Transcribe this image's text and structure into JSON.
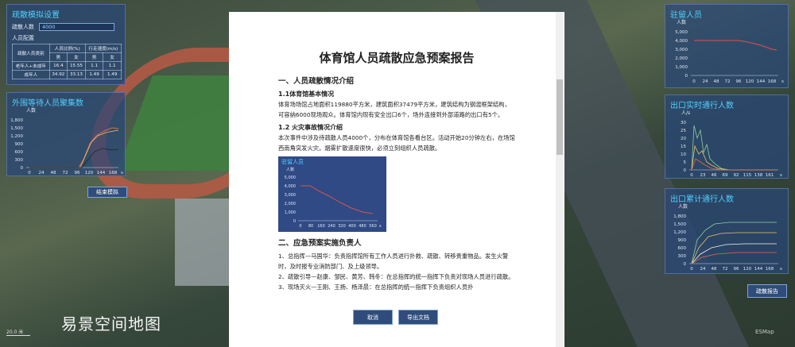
{
  "left_panel": {
    "title": "疏散模拟设置",
    "count_label": "疏散人数",
    "count_value": "4000",
    "people_config_label": "人员配置",
    "table_headers": [
      "疏散人员类别",
      "人员比例(%)",
      "行走速度(m/s)"
    ],
    "sub_headers": [
      "男",
      "女",
      "男",
      "女"
    ],
    "rows": [
      {
        "label": "老年人+未成年",
        "vals": [
          "16.4",
          "15.55",
          "1.1",
          "1.1"
        ]
      },
      {
        "label": "成年人",
        "vals": [
          "34.92",
          "33.13",
          "1.49",
          "1.49"
        ]
      }
    ]
  },
  "gather_panel": {
    "title": "外围等待人员聚集数",
    "ylabel": "人数",
    "yticks": [
      "1,800",
      "1,500",
      "1,200",
      "900",
      "600",
      "300",
      "0"
    ],
    "xticks": [
      "0",
      "24",
      "48",
      "72",
      "96",
      "120",
      "144",
      "168"
    ],
    "xunit": "s"
  },
  "end_button": "结束模拟",
  "right_top": {
    "title": "驻留人员",
    "ylabel": "人数",
    "yticks": [
      "5,000",
      "4,000",
      "3,000",
      "2,000",
      "1,000",
      "0"
    ],
    "xticks": [
      "0",
      "24",
      "48",
      "72",
      "96",
      "120",
      "144",
      "168"
    ],
    "xunit": "s"
  },
  "right_mid": {
    "title": "出口实时通行人数",
    "ylabel": "人/s",
    "yticks": [
      "30",
      "25",
      "20",
      "15",
      "10",
      "5",
      "0"
    ],
    "xticks": [
      "0",
      "23",
      "46",
      "69",
      "92",
      "115",
      "138",
      "161"
    ],
    "xunit": "s"
  },
  "right_bot": {
    "title": "出口累计通行人数",
    "ylabel": "人数",
    "yticks": [
      "1,800",
      "1,500",
      "1,200",
      "900",
      "600",
      "300",
      "0"
    ],
    "xticks": [
      "0",
      "24",
      "48",
      "72",
      "96",
      "120",
      "144",
      "168"
    ],
    "xunit": "s"
  },
  "report_button": "疏散报告",
  "report": {
    "title": "体育馆人员疏散应急预案报告",
    "s1": "一、人员疏散情况介绍",
    "s1_1": "1.1体育馆基本情况",
    "p1": "体育场场馆占地面积119880平方米，建筑面积37479平方米，建筑结构为钢混框架结构，可容纳6000现场观众。体育馆内现有安全出口6个，场外连接到外部道路的出口有5个。",
    "s1_2": "1.2 火灾事故情况介绍",
    "p2": "本次事件中涉及待疏散人员4000个，分布在体育馆各看台区。活动开始20分钟左右，在场馆西南角突发火灾。烟雾扩散速度很快，必须立刻组织人员疏散。",
    "chart_title": "驻留人员",
    "chart_ylabel": "人数",
    "chart_yticks": [
      "5,000",
      "4,000",
      "3,000",
      "2,000",
      "1,000",
      "0"
    ],
    "chart_xticks": [
      "0",
      "80",
      "160",
      "240",
      "320",
      "400",
      "480",
      "560"
    ],
    "chart_xunit": "s",
    "s2": "二、应急预案实施负责人",
    "p3": "1、总指挥—马国华：负责指挥馆所有工作人员进行扑救、疏散、转移贵重物品。发生火警时，及时报专业消防部门、及上级领导。",
    "p4": "2、疏散引导—赵康、邹民、黄芳、韩冬：在总指挥的统一指挥下负责对现场人员进行疏散。",
    "p5": "3、现场灭火—王刚、王扬、杨泽晨：在总指挥的统一指挥下负责组织人员扑"
  },
  "cancel_button": "取消",
  "export_button": "导出文档",
  "watermark": "易景空间地图",
  "scale_text": "20.0 米",
  "logo_text": "ESMap"
}
